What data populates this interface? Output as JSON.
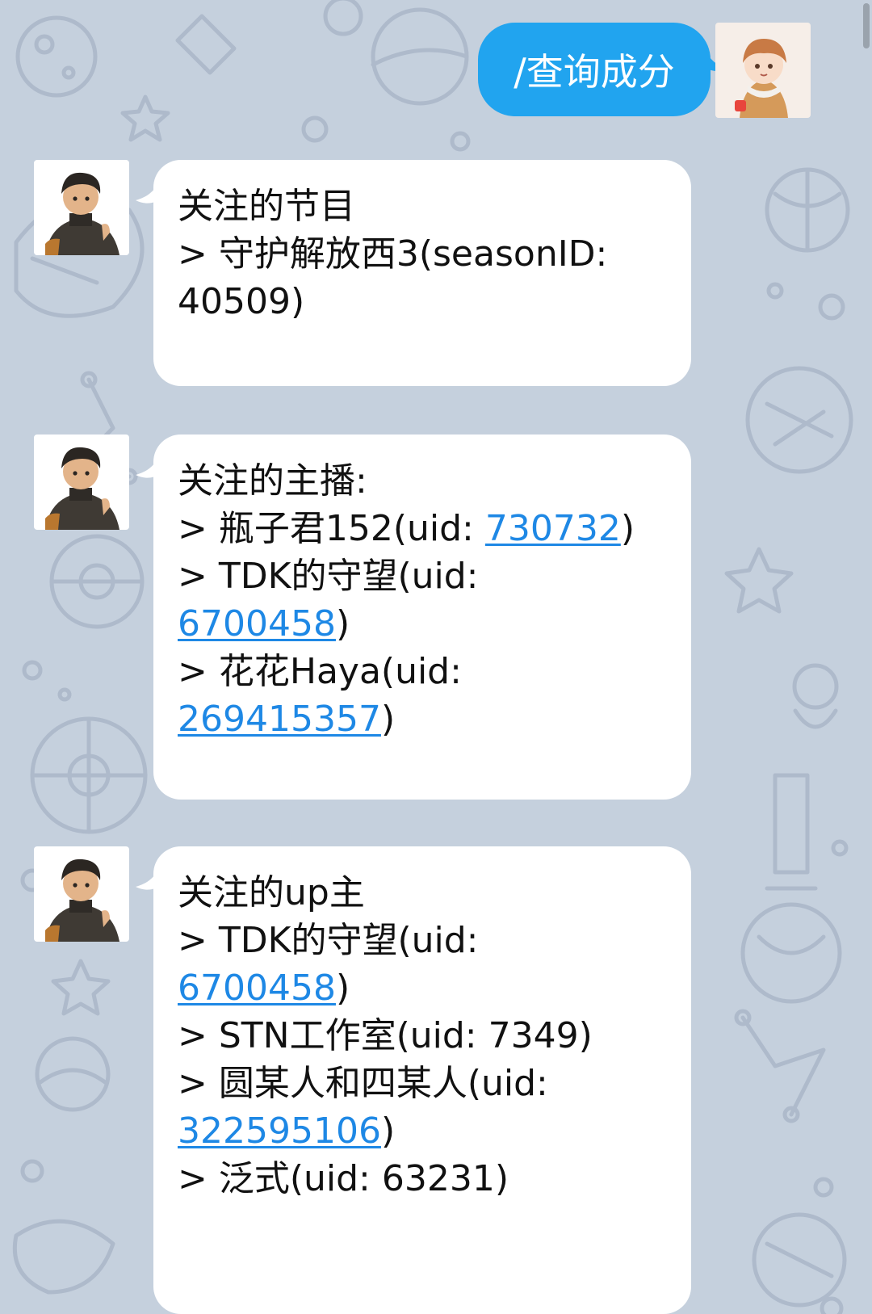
{
  "theme": {
    "background": "#c5d0dd",
    "sent_bubble": "#21a4ef",
    "received_bubble": "#ffffff",
    "link": "#1e88e5"
  },
  "sent_message": {
    "text": "/查询成分"
  },
  "messages": [
    {
      "lines": [
        {
          "text": "关注的节目"
        },
        {
          "text": "> 守护解放西3(seasonID:"
        },
        {
          "text": "40509)"
        }
      ]
    },
    {
      "lines": [
        {
          "text": "关注的主播:"
        },
        {
          "prefix": "> 瓶子君152(uid: ",
          "link": "730732",
          "suffix": ")"
        },
        {
          "text": "> TDK的守望(uid:"
        },
        {
          "prefix": "",
          "link": "6700458",
          "suffix": ")"
        },
        {
          "text": "> 花花Haya(uid:"
        },
        {
          "prefix": "",
          "link": "269415357",
          "suffix": ")"
        }
      ]
    },
    {
      "lines": [
        {
          "text": "关注的up主"
        },
        {
          "text": "> TDK的守望(uid:"
        },
        {
          "prefix": "",
          "link": "6700458",
          "suffix": ")"
        },
        {
          "text": "> STN工作室(uid: 7349)"
        },
        {
          "text": "> 圆某人和四某人(uid:"
        },
        {
          "prefix": "",
          "link": "322595106",
          "suffix": ")"
        },
        {
          "text": "> 泛式(uid: 63231)"
        }
      ]
    }
  ],
  "icons": {
    "wallpaper": "space-doodle-pattern",
    "bot_avatar": "anime-man-avatar",
    "user_avatar": "anime-girl-avatar"
  }
}
